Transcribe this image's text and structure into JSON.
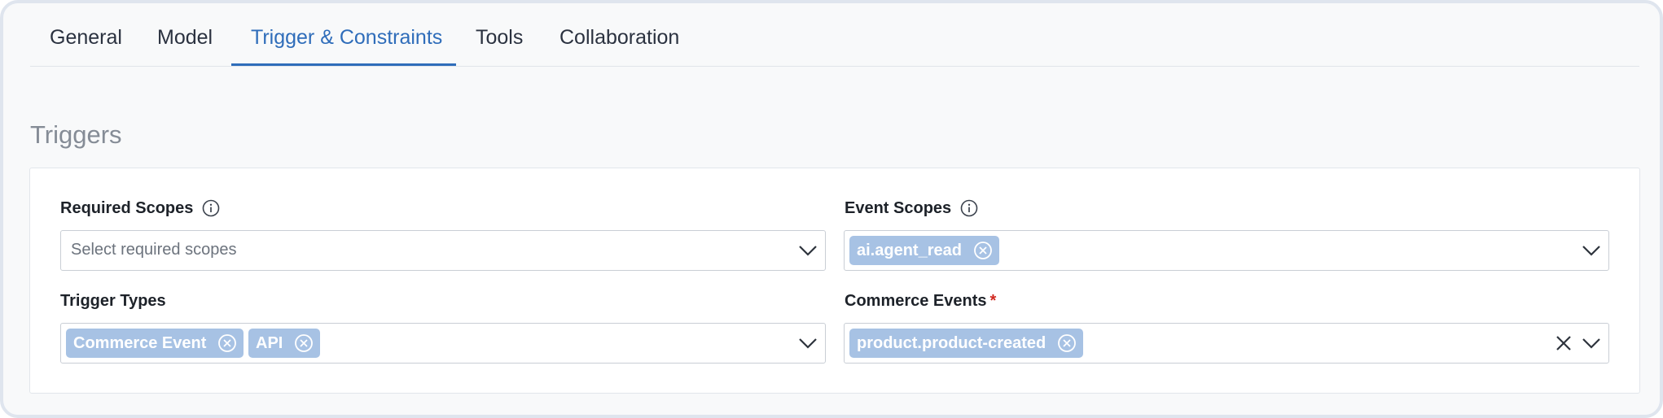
{
  "tabs": [
    {
      "label": "General"
    },
    {
      "label": "Model"
    },
    {
      "label": "Trigger & Constraints",
      "active": true
    },
    {
      "label": "Tools"
    },
    {
      "label": "Collaboration"
    }
  ],
  "section": {
    "title": "Triggers"
  },
  "fields": {
    "required_scopes": {
      "label": "Required Scopes",
      "info_icon": "info-icon",
      "placeholder": "Select required scopes"
    },
    "event_scopes": {
      "label": "Event Scopes",
      "info_icon": "info-icon",
      "chips": [
        {
          "label": "ai.agent_read"
        }
      ]
    },
    "trigger_types": {
      "label": "Trigger Types",
      "chips": [
        {
          "label": "Commerce Event"
        },
        {
          "label": "API"
        }
      ]
    },
    "commerce_events": {
      "label": "Commerce Events",
      "required_marker": "*",
      "chips": [
        {
          "label": "product.product-created"
        }
      ]
    }
  },
  "colors": {
    "accent": "#2f6dba",
    "chip_bg": "#a7c2e4",
    "required": "#d0281f"
  }
}
